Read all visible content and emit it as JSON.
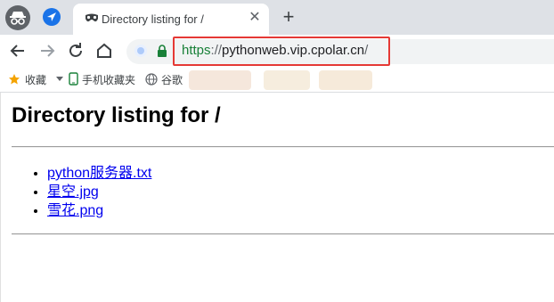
{
  "browser": {
    "incognito_icon": "incognito-icon",
    "extension_icon": "navigation-arrow-icon",
    "tab": {
      "title": "Directory listing for /",
      "icon": "incognito-mask-icon",
      "close_label": "✕"
    },
    "new_tab_label": "+",
    "toolbar": {
      "back_icon": "back-arrow-icon",
      "forward_icon": "forward-arrow-icon",
      "reload_icon": "reload-icon",
      "home_icon": "home-icon",
      "url_scheme": "https",
      "url_separator": "://",
      "url_host": "pythonweb.vip.cpolar.cn",
      "url_path": "/",
      "highlight_color": "#e53935"
    },
    "bookmarks": [
      {
        "label": "收藏",
        "icon": "star-icon"
      },
      {
        "label": "手机收藏夹",
        "icon": "phone-icon"
      },
      {
        "label": "谷歌",
        "icon": "globe-icon"
      }
    ]
  },
  "page": {
    "heading": "Directory listing for /",
    "files": [
      {
        "name": "python服务器.txt"
      },
      {
        "name": "星空.jpg"
      },
      {
        "name": "雪花.png"
      }
    ]
  },
  "colors": {
    "link": "#0000ee",
    "secure": "#188038",
    "tabstrip": "#dee1e6"
  }
}
